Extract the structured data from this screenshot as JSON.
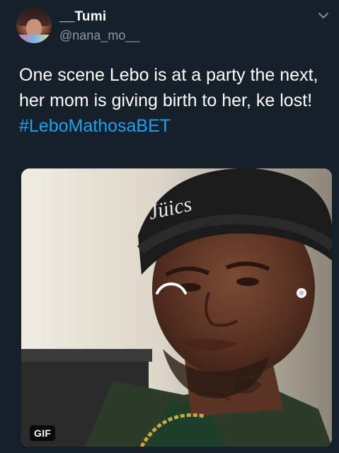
{
  "tweet": {
    "display_name": "__Tumi",
    "handle": "@nana_mo__",
    "text_plain": "One scene Lebo is at a party the next, her mom is giving birth to her, ke lost! ",
    "hashtag": "#LeboMathosaBET",
    "media": {
      "badge": "GIF",
      "beanie_text": "Jüics"
    }
  },
  "icons": {
    "menu": "chevron-down-icon",
    "loading": "loading-spinner-icon"
  },
  "colors": {
    "background": "#15202b",
    "name": "#ffffff",
    "handle": "#8899a6",
    "hashtag": "#1da1f2"
  }
}
